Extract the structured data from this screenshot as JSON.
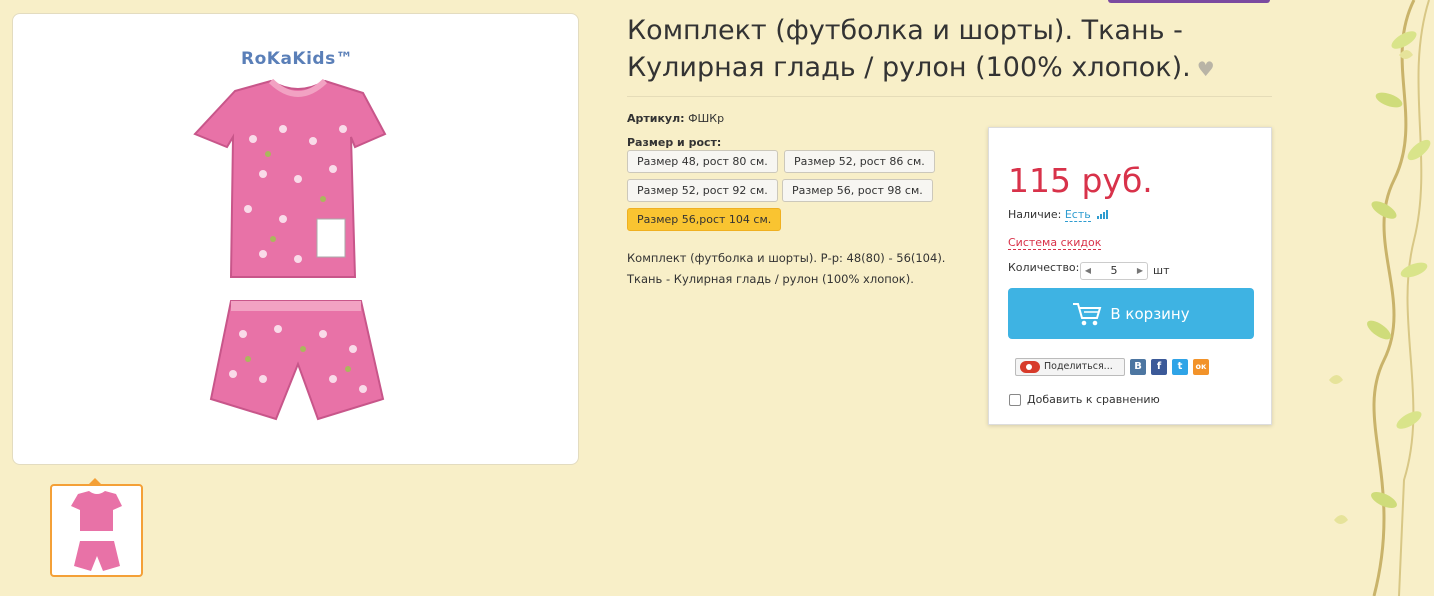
{
  "product": {
    "title": "Комплект (футболка и шорты). Ткань - Кулирная гладь / рулон (100% хлопок).",
    "brand_logo": "RoKaKids™",
    "sku_label": "Артикул:",
    "sku_value": "ФШКр",
    "size_label": "Размер и рост:",
    "sizes": [
      {
        "label": "Размер 48, рост 80 см.",
        "active": false
      },
      {
        "label": "Размер 52, рост 86 см.",
        "active": false
      },
      {
        "label": "Размер 52, рост 92 см.",
        "active": false
      },
      {
        "label": "Размер 56, рост 98 см.",
        "active": false
      },
      {
        "label": "Размер 56,рост 104 см.",
        "active": true
      }
    ],
    "description_line1": "Комплект (футболка и шорты). Р-р: 48(80) - 56(104).",
    "description_line2": "Ткань - Кулирная гладь / рулон (100% хлопок)."
  },
  "buy_box": {
    "price": "115 руб.",
    "availability_label": "Наличие:",
    "availability_value": "Есть",
    "discount_link": "Система скидок",
    "quantity_label": "Количество:",
    "quantity_value": "5",
    "quantity_unit": "шт",
    "cart_button": "В корзину",
    "share_button": "Поделиться...",
    "social": [
      "В",
      "f",
      "t",
      "ок"
    ],
    "compare_label": "Добавить к сравнению"
  },
  "colors": {
    "background": "#f8efc8",
    "price": "#d8324a",
    "cart_button": "#3eb3e3",
    "active_size": "#f9c431",
    "thumb_border": "#f4a037"
  }
}
